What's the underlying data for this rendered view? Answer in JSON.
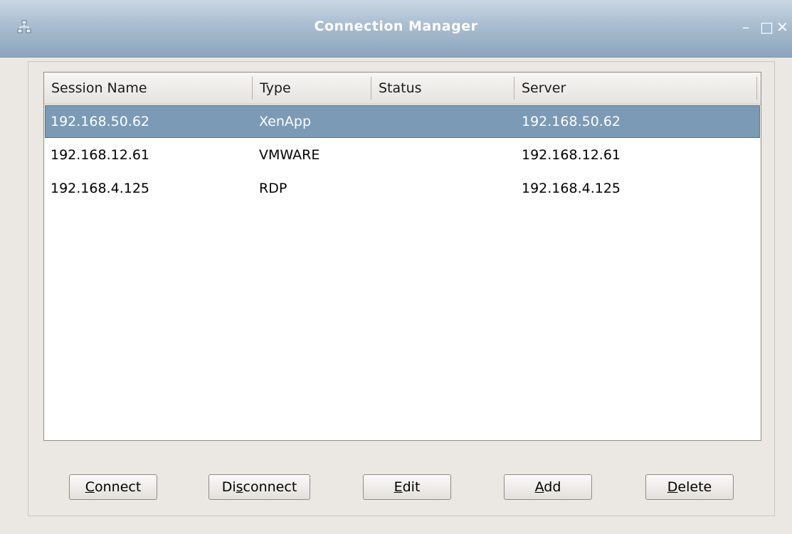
{
  "window": {
    "title": "Connection Manager",
    "controls": {
      "minimize": "–",
      "maximize": "□",
      "close": "✕"
    },
    "icon": "network-icon"
  },
  "table": {
    "columns": [
      "Session Name",
      "Type",
      "Status",
      "Server"
    ],
    "rows": [
      {
        "session_name": "192.168.50.62",
        "type": "XenApp",
        "status": "",
        "server": "192.168.50.62",
        "selected": true
      },
      {
        "session_name": "192.168.12.61",
        "type": "VMWARE",
        "status": "",
        "server": "192.168.12.61",
        "selected": false
      },
      {
        "session_name": "192.168.4.125",
        "type": "RDP",
        "status": "",
        "server": "192.168.4.125",
        "selected": false
      }
    ]
  },
  "buttons": {
    "connect": {
      "mnemonic": "C",
      "rest": "onnect"
    },
    "disconnect": {
      "pre": "Di",
      "mnemonic": "s",
      "rest": "connect"
    },
    "edit": {
      "mnemonic": "E",
      "rest": "dit"
    },
    "add": {
      "mnemonic": "A",
      "rest": "dd"
    },
    "delete": {
      "mnemonic": "D",
      "rest": "elete"
    }
  },
  "colors": {
    "titlebar": "#8ca6be",
    "selection": "#7b9ab5",
    "background": "#ebe8e4"
  }
}
